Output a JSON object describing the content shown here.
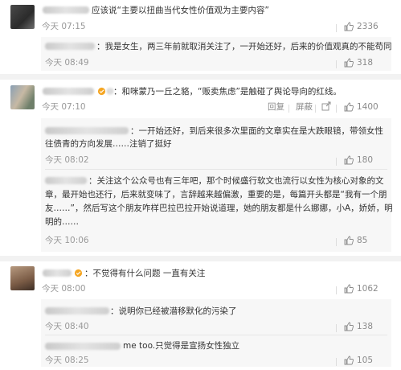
{
  "comments": [
    {
      "text": "应该说“主要以扭曲当代女性价值观为主要内容”",
      "time": "今天 07:15",
      "likes": "2336",
      "reply": {
        "text": "：我是女生，两三年前就取消关注了，一开始还好，后来的价值观真的不能苟同",
        "time": "今天 08:49",
        "likes": "318"
      }
    },
    {
      "text": "：和咪蒙乃一丘之貉，“贩卖焦虑”是触碰了舆论导向的红线。",
      "time": "今天 07:10",
      "reply_label": "回复",
      "delete_label": "屏蔽",
      "likes": "1400",
      "replies": [
        {
          "lines": [
            "：一开始还好，到后来很多次里面的文章实在是大跌眼镜，带领女性",
            "往债青的方向发展……注销了挺好"
          ],
          "time": "今天 08:02",
          "likes": "180"
        },
        {
          "lines": [
            "：关注这个公众号也有三年吧，那个时候盛行软文也流行以女性为核心对象的文",
            "章，最开始也还行，后来就变味了，言辞越来越偏激，重要的是，每篇开头都是“我有一个朋",
            "友……”，然后写这个朋友咋样巴拉巴拉开始说道理，她的朋友都是什么娜娜，小A，娇娇，明",
            "明的……"
          ],
          "time": "今天 10:06",
          "likes": "85"
        }
      ]
    },
    {
      "text": "：不觉得有什么问题 一直有关注",
      "time": "今天 08:00",
      "likes": "1062",
      "replies": [
        {
          "text": "：说明你已经被潜移默化的污染了",
          "time": "今天 08:40",
          "likes": "138"
        },
        {
          "text": "me too.只觉得是宣扬女性独立",
          "time": "今天 08:25",
          "likes": "105"
        }
      ]
    }
  ]
}
